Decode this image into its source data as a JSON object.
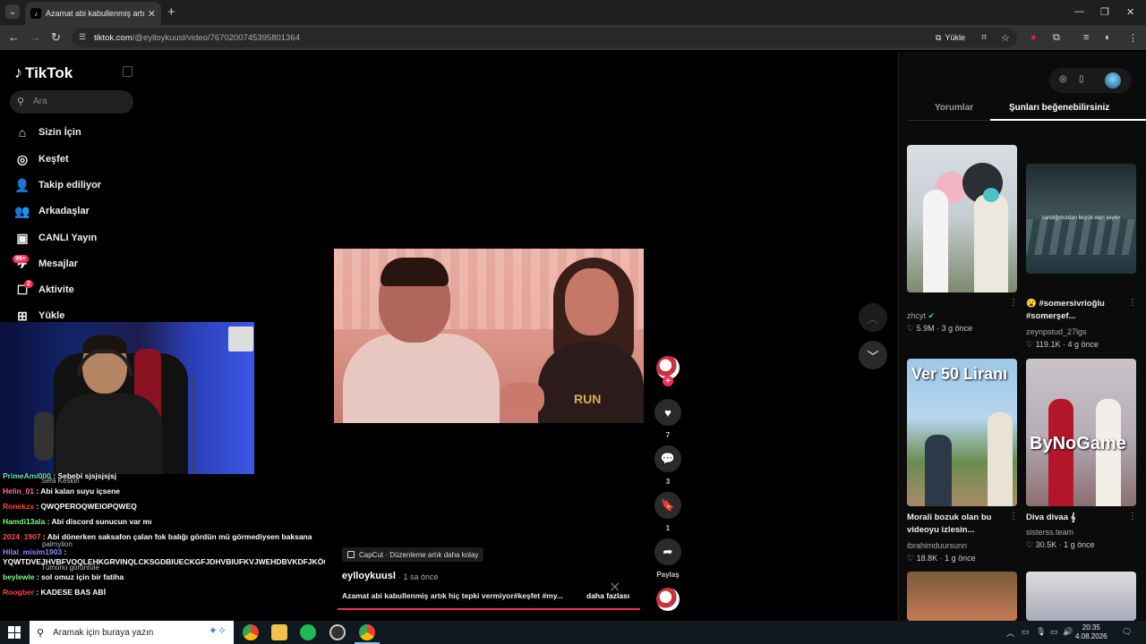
{
  "browser": {
    "tab_title": "Azamat abi kabullenmiş artık hiç",
    "url_domain": "tiktok.com",
    "url_path": "/@eylloykuusl/video/7670200745395801364",
    "upload_label": "Yükle"
  },
  "sidebar": {
    "logo": "TikTok",
    "search_placeholder": "Ara",
    "items": [
      {
        "label": "Sizin İçin",
        "icon": "home-icon"
      },
      {
        "label": "Keşfet",
        "icon": "compass-icon"
      },
      {
        "label": "Takip ediliyor",
        "icon": "person-add-icon"
      },
      {
        "label": "Arkadaşlar",
        "icon": "friends-icon"
      },
      {
        "label": "CANLI Yayın",
        "icon": "live-tv-icon"
      },
      {
        "label": "Mesajlar",
        "icon": "message-icon",
        "badge": "99+"
      },
      {
        "label": "Aktivite",
        "icon": "activity-icon",
        "badge": "2"
      },
      {
        "label": "Yükle",
        "icon": "upload-icon"
      }
    ]
  },
  "chat": {
    "lines": [
      {
        "user": "PrimeAmi000",
        "text": ": Sebebi sjsjsjsjsj",
        "color": "#6fe3c8"
      },
      {
        "user": "Helin_01",
        "text": ": Abi kalan suyu içsene",
        "color": "#ff6ab0"
      },
      {
        "user": "Ronekzx",
        "text": ": QWQPEROQWEIOPQWEQ",
        "color": "#ff4040"
      },
      {
        "user": "Hamdi13ala",
        "text": ": Abi discord sunucun var mı",
        "color": "#7cff7c"
      },
      {
        "user": "2024_1907",
        "text": ": Abi dönerken saksafon çalan fok balığı gördün mü görmediysen baksana",
        "color": "#ff5050"
      },
      {
        "user": "Hilal_misim1903",
        "text": ": YQWTDVEJHVBFVOQLEHKGRVINQLCKSGDBIUECKGFJDHVBIUFKVJWEHDBVKDFJKÖCX",
        "color": "#8a8aff"
      },
      {
        "user": "beylewle",
        "text": ": sol omuz için bir fatiha",
        "color": "#7cff7c"
      },
      {
        "user": "Roogber",
        "text": ": KADESE BAS ABİ",
        "color": "#ff4040"
      }
    ],
    "ghosts": [
      "Sefa Keskin",
      "palmylion",
      "Tümünü görüntüle"
    ]
  },
  "video": {
    "shirt_text": "RUN",
    "capcut_label": "CapCut · Düzenleme artık daha kolay",
    "author": "eylloykuusl",
    "posted": "· 1 sa önce",
    "caption": "Azamat abi kabullenmiş artık hiç tepki vermiyor#keşfet #my...",
    "more_label": "daha fazlası",
    "progress": 1.0
  },
  "actions": {
    "likes": "7",
    "comments": "3",
    "saves": "1",
    "share_label": "Paylaş"
  },
  "right_panel": {
    "tabs": [
      "Yorumlar",
      "Şunları beğenebilirsiniz"
    ],
    "active_tab": 1,
    "cards": [
      {
        "title": "",
        "user": "zhcyt",
        "verified": true,
        "likes": "5.9M",
        "age": "3 g önce"
      },
      {
        "title": "😮 #somersivrioğlu #somerşef...",
        "overlay": "sandığımızdan büyük olan şeyler",
        "user": "zeynpstud_27lgs",
        "likes": "119.1K",
        "age": "4 g önce"
      },
      {
        "title": "Morali bozuk olan bu videoyu izlesin...",
        "overlay": "Ver 50 Liranı",
        "user": "ibrahimduursunn",
        "likes": "18.8K",
        "age": "1 g önce"
      },
      {
        "title": "Diva divaa 𝄞",
        "overlay": "ByNoGame",
        "user": "sisterss.team",
        "likes": "30.5K",
        "age": "1 g önce"
      }
    ]
  },
  "taskbar": {
    "search_placeholder": "Aramak için buraya yazın",
    "time": "20:35",
    "date": "4.08.2026"
  },
  "colors": {
    "accent": "#fe2c55",
    "background": "#000000"
  }
}
